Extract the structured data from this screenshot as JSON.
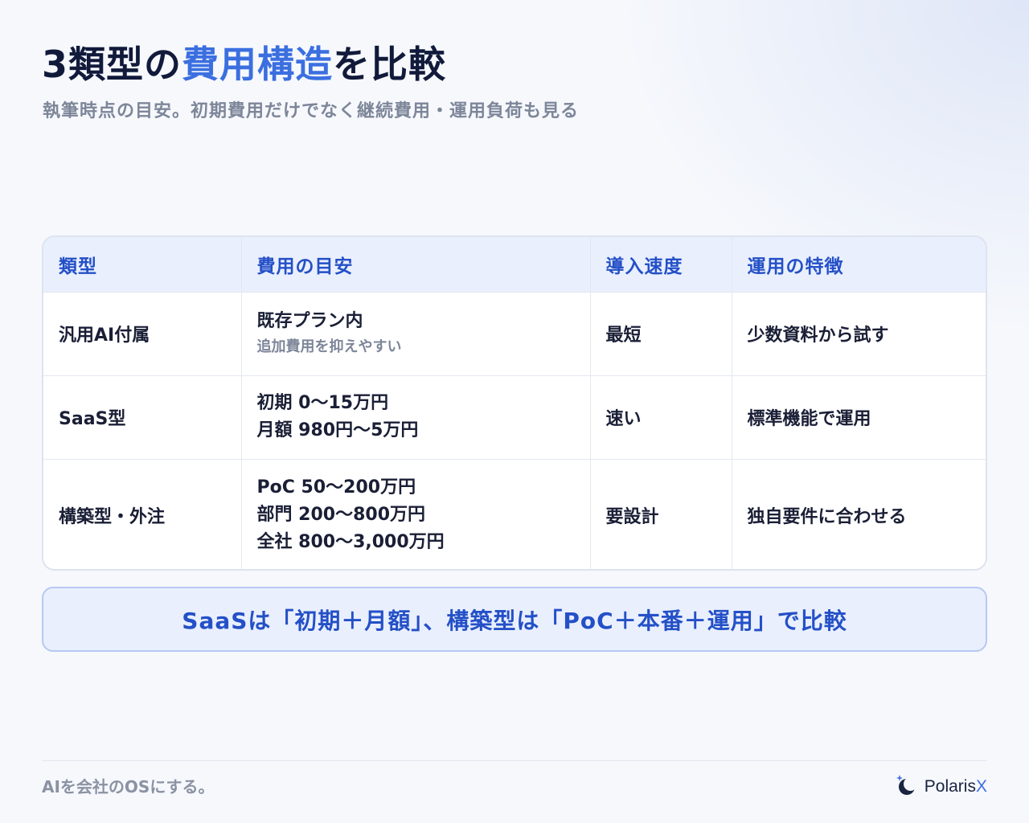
{
  "title": {
    "prefix": "3類型の",
    "accent": "費用構造",
    "suffix": "を比較"
  },
  "subtitle": "執筆時点の目安。初期費用だけでなく継続費用・運用負荷も見る",
  "table": {
    "headers": [
      "類型",
      "費用の目安",
      "導入速度",
      "運用の特徴"
    ],
    "rows": [
      {
        "type": "汎用AI付属",
        "cost": [
          "既存プラン内"
        ],
        "cost_note": "追加費用を抑えやすい",
        "speed": "最短",
        "feature": "少数資料から試す"
      },
      {
        "type": "SaaS型",
        "cost": [
          "初期 0〜15万円",
          "月額 980円〜5万円"
        ],
        "speed": "速い",
        "feature": "標準機能で運用"
      },
      {
        "type": "構築型・外注",
        "cost": [
          "PoC 50〜200万円",
          "部門 200〜800万円",
          "全社 800〜3,000万円"
        ],
        "speed": "要設計",
        "feature": "独自要件に合わせる"
      }
    ]
  },
  "callout": "SaaSは「初期＋月額」、構築型は「PoC＋本番＋運用」で比較",
  "footer": {
    "tagline": "AIを会社のOSにする。",
    "brand_name": "Polaris",
    "brand_x": "X"
  },
  "colors": {
    "accent": "#3b6fe0",
    "header_text": "#2450c7",
    "title": "#111a3a",
    "muted": "#7d8699"
  },
  "icons": {
    "brand_logo": "moon-star-logo-icon"
  }
}
